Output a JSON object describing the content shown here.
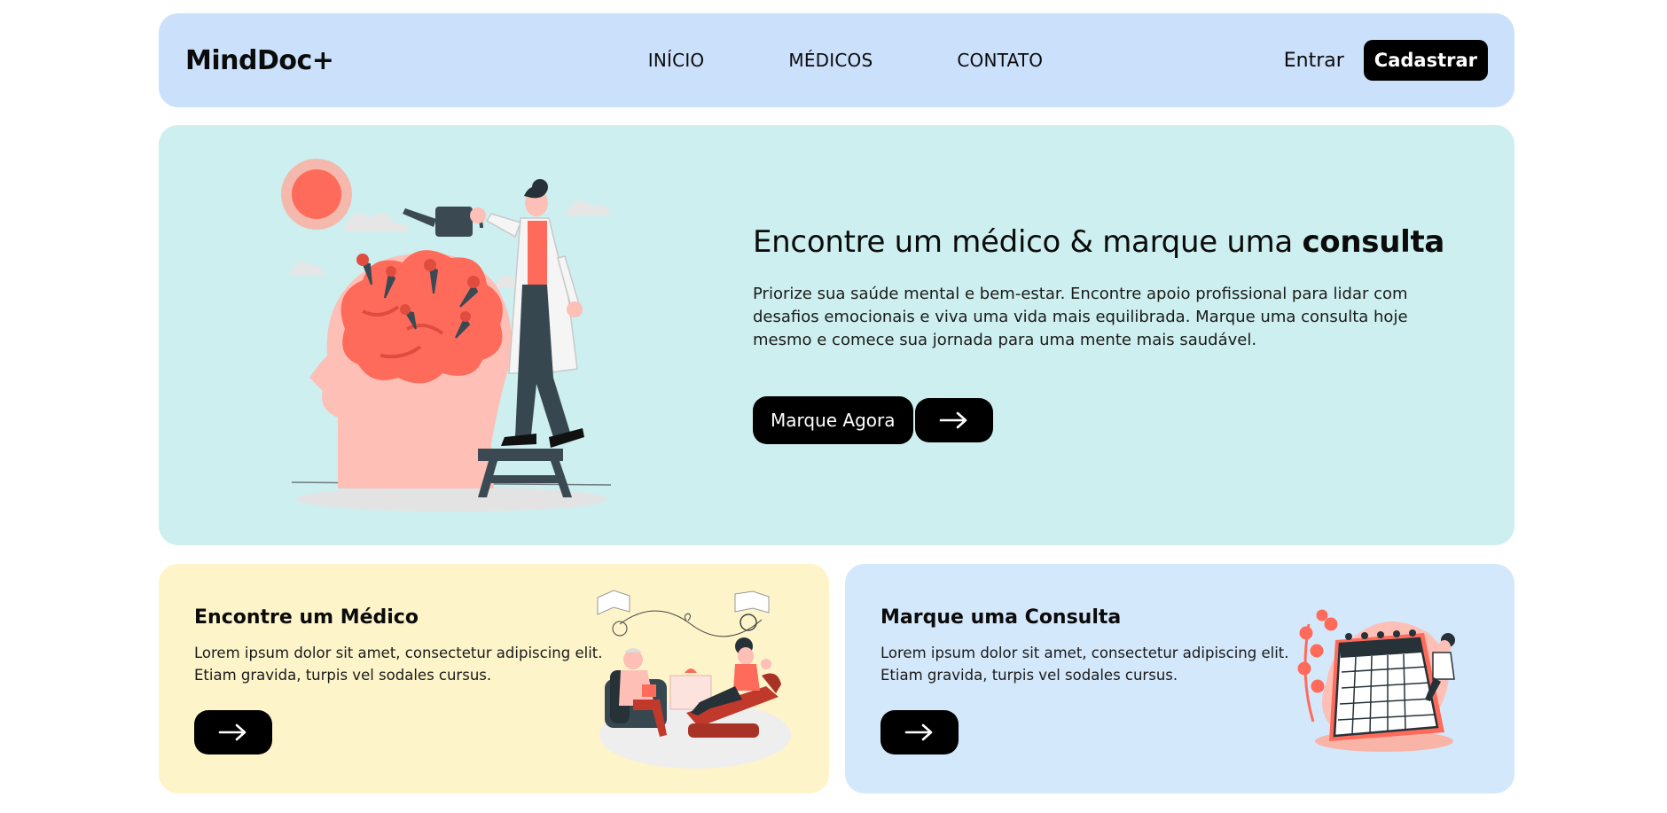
{
  "navbar": {
    "logo": "MindDoc+",
    "links": [
      "INÍCIO",
      "MÉDICOS",
      "CONTATO"
    ],
    "login_label": "Entrar",
    "signup_label": "Cadastrar"
  },
  "hero": {
    "title_regular": "Encontre um médico & marque uma ",
    "title_bold": "consulta",
    "text": "Priorize sua saúde mental e bem-estar. Encontre apoio profissional para lidar com desafios emocionais e viva uma vida mais equilibrada. Marque uma consulta hoje mesmo e comece sua jornada para uma mente mais saudável.",
    "cta_label": "Marque Agora",
    "illustration": "watering-brain-illustration"
  },
  "cards": [
    {
      "title": "Encontre um Médico",
      "text": "Lorem ipsum dolor sit amet, consectetur adipiscing elit. Etiam gravida, turpis vel sodales cursus.",
      "illustration": "therapy-session-illustration"
    },
    {
      "title": "Marque uma Consulta",
      "text": "Lorem ipsum dolor sit amet, consectetur adipiscing elit. Etiam gravida, turpis vel sodales cursus.",
      "illustration": "calendar-illustration"
    }
  ],
  "icons": {
    "arrow": "arrow-right-icon"
  },
  "colors": {
    "navbar_bg": "#cbe0fa",
    "hero_bg": "#cdefef",
    "card_doctor_bg": "#fdf4c9",
    "card_appoint_bg": "#d4e8fb",
    "accent": "#ff6b5b",
    "button": "#000000"
  }
}
